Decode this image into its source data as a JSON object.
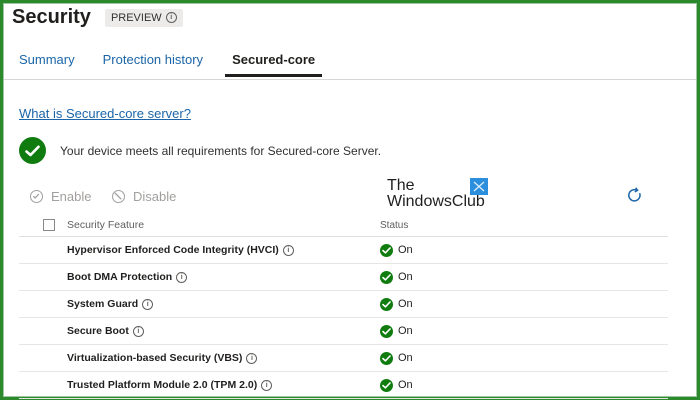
{
  "page": {
    "title": "Security",
    "badge": "PREVIEW"
  },
  "tabs": [
    {
      "label": "Summary",
      "active": false
    },
    {
      "label": "Protection history",
      "active": false
    },
    {
      "label": "Secured-core",
      "active": true
    }
  ],
  "link": "What is Secured-core server?",
  "banner": "Your device meets all requirements for Secured-core Server.",
  "commands": {
    "enable": "Enable",
    "disable": "Disable"
  },
  "watermark": {
    "line1": "The",
    "line2": "WindowsClub"
  },
  "table": {
    "columns": {
      "feature": "Security Feature",
      "status": "Status"
    },
    "rows": [
      {
        "feature": "Hypervisor Enforced Code Integrity (HVCI)",
        "status": "On"
      },
      {
        "feature": "Boot DMA Protection",
        "status": "On"
      },
      {
        "feature": "System Guard",
        "status": "On"
      },
      {
        "feature": "Secure Boot",
        "status": "On"
      },
      {
        "feature": "Virtualization-based Security (VBS)",
        "status": "On"
      },
      {
        "feature": "Trusted Platform Module 2.0 (TPM 2.0)",
        "status": "On"
      }
    ]
  },
  "colors": {
    "frame": "#2c8a2c",
    "success": "#107c10",
    "link": "#1b65a8"
  }
}
